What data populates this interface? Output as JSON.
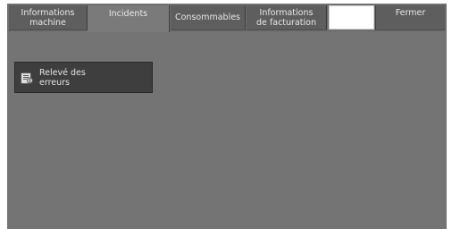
{
  "tabs": [
    {
      "line1": "Informations",
      "line2": "machine",
      "active": false
    },
    {
      "line1": "Incidents",
      "line2": "",
      "active": true
    },
    {
      "line1": "Consommables",
      "line2": "",
      "active": false
    },
    {
      "line1": "Informations",
      "line2": "de facturation",
      "active": false
    }
  ],
  "close_label": "Fermer",
  "feature": {
    "line1": "Relevé des",
    "line2": "erreurs",
    "icon": "error-report-icon"
  },
  "colors": {
    "background": "#747474",
    "tab": "#5e5e5e",
    "active_tab": "#7a7a7a",
    "button": "#3e3e3e",
    "text": "#e8e8e8"
  }
}
